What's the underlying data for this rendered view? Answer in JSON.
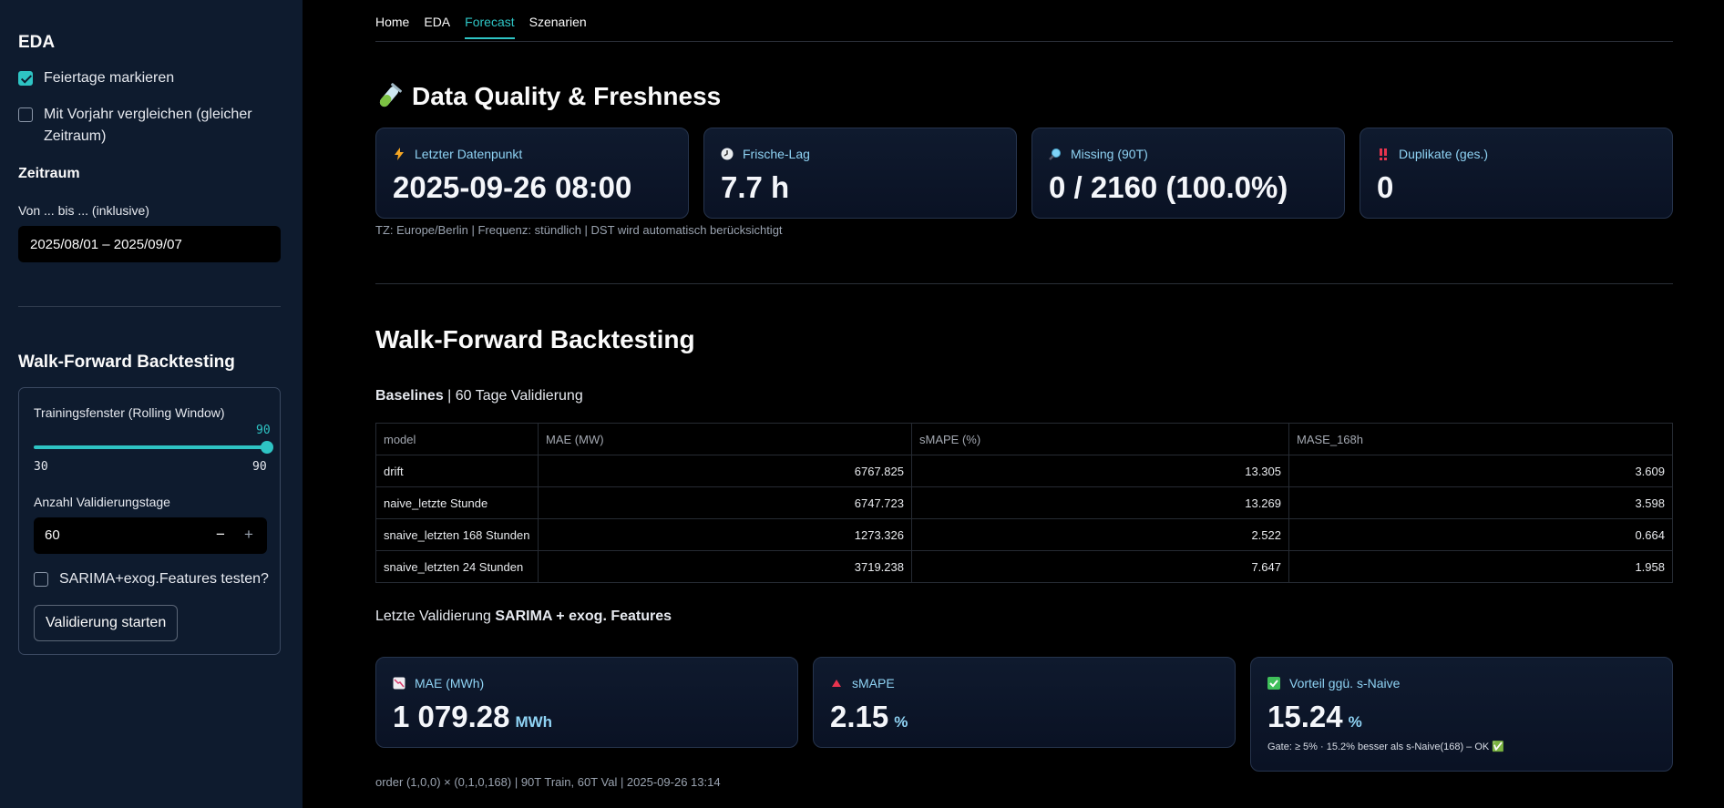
{
  "sidebar": {
    "eda_title": "EDA",
    "holidays_label": "Feiertage markieren",
    "holidays_checked": true,
    "prev_year_label": "Mit Vorjahr vergleichen (gleicher Zeitraum)",
    "prev_year_checked": false,
    "period_title": "Zeitraum",
    "range_label": "Von ... bis ... (inklusive)",
    "range_value": "2025/08/01 – 2025/09/07",
    "backtest_title": "Walk-Forward Backtesting",
    "window_label": "Trainingsfenster (Rolling Window)",
    "window_value": "90",
    "window_fraction": 1.0,
    "window_min": "30",
    "window_max": "90",
    "val_days_label": "Anzahl Validierungstage",
    "val_days_value": "60",
    "minus": "−",
    "plus": "+",
    "sarima_label": "SARIMA+exog.Features testen?",
    "sarima_checked": false,
    "start_button": "Validierung starten"
  },
  "tabs": [
    "Home",
    "EDA",
    "Forecast",
    "Szenarien"
  ],
  "active_tab": "Forecast",
  "quality": {
    "title_icon": "test-tube-icon",
    "title": "Data Quality & Freshness",
    "cards": [
      {
        "icon": "lightning-icon",
        "label": "Letzter Datenpunkt",
        "value": "2025-09-26 08:00"
      },
      {
        "icon": "clock-icon",
        "label": "Frische-Lag",
        "value": "7.7 h"
      },
      {
        "icon": "magnifier-icon",
        "label": "Missing (90T)",
        "value": "0 / 2160 (100.0%)"
      },
      {
        "icon": "double-exclamation-icon",
        "label": "Duplikate (ges.)",
        "value": "0"
      }
    ],
    "caption": "TZ: Europe/Berlin | Frequenz: stündlich | DST wird automatisch berücksichtigt"
  },
  "backtest": {
    "title": "Walk-Forward Backtesting",
    "baselines_bold": "Baselines",
    "baselines_rest": " | 60 Tage Validierung",
    "columns": [
      "model",
      "MAE (MW)",
      "sMAPE (%)",
      "MASE_168h"
    ],
    "rows": [
      [
        "drift",
        "6767.825",
        "13.305",
        "3.609"
      ],
      [
        "naive_letzte Stunde",
        "6747.723",
        "13.269",
        "3.598"
      ],
      [
        "snaive_letzten 168 Stunden",
        "1273.326",
        "2.522",
        "0.664"
      ],
      [
        "snaive_letzten 24 Stunden",
        "3719.238",
        "7.647",
        "1.958"
      ]
    ],
    "last_val_prefix": "Letzte Validierung ",
    "last_val_bold": "SARIMA + exog. Features",
    "metrics": [
      {
        "icon": "chart-down-icon",
        "label": "MAE (MWh)",
        "value": "1 079.28",
        "unit": "MWh"
      },
      {
        "icon": "triangle-up-icon",
        "label": "sMAPE",
        "value": "2.15",
        "unit": "%"
      },
      {
        "icon": "check-box-icon",
        "label": "Vorteil ggü. s-Naive",
        "value": "15.24",
        "unit": "%",
        "note": "Gate: ≥ 5% · 15.2% besser als s-Naive(168) – OK ✅"
      }
    ],
    "footer": "order (1,0,0) × (0,1,0,168) | 90T Train, 60T Val | 2025-09-26 13:14"
  }
}
